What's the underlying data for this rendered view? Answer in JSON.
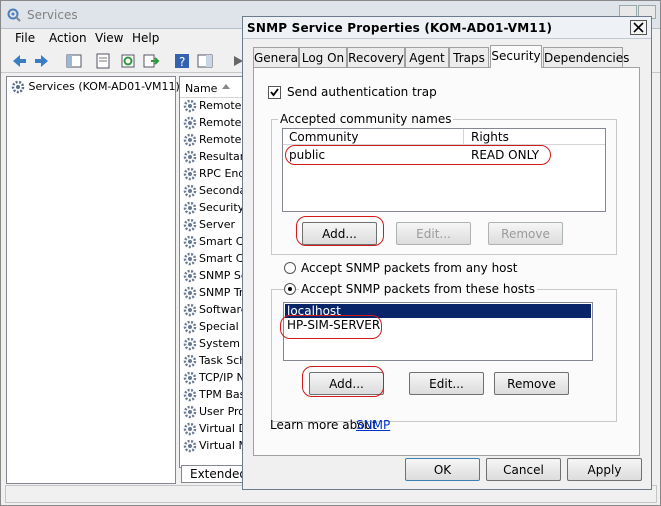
{
  "services_window": {
    "title": "Services",
    "menu": [
      "File",
      "Action",
      "View",
      "Help"
    ],
    "tree_root": "Services (KOM-AD01-VM11)",
    "list_column": "Name",
    "list_items": [
      "Remote",
      "Remote",
      "Remote",
      "Resultar",
      "RPC End",
      "Seconda",
      "Security",
      "Server",
      "Smart Ca",
      "Smart Ca",
      "SNMP Se",
      "SNMP Tr",
      "Software",
      "Special A",
      "System E",
      "Task Sch",
      "TCP/IP N",
      "TPM Bas",
      "User Pro",
      "Virtual D",
      "Virtual M"
    ],
    "bottom_tab": "Extended"
  },
  "dialog": {
    "title": "SNMP Service Properties (KOM-AD01-VM11)",
    "tabs": [
      "General",
      "Log On",
      "Recovery",
      "Agent",
      "Traps",
      "Security",
      "Dependencies"
    ],
    "active_tab": "Security",
    "send_auth_trap_label": "Send authentication trap",
    "send_auth_trap_checked": true,
    "community_group_title": "Accepted community names",
    "community_columns": [
      "Community",
      "Rights"
    ],
    "community_rows": [
      {
        "community": "public",
        "rights": "READ ONLY"
      }
    ],
    "community_buttons": {
      "add": "Add...",
      "edit": "Edit...",
      "remove": "Remove"
    },
    "accept_any_host_label": "Accept SNMP packets from any host",
    "accept_these_hosts_label": "Accept SNMP packets from these hosts",
    "selected_radio": "these_hosts",
    "hosts": [
      "localhost",
      "HP-SIM-SERVER"
    ],
    "selected_host": "localhost",
    "host_buttons": {
      "add": "Add...",
      "edit": "Edit...",
      "remove": "Remove"
    },
    "learn_more_text": "Learn more about",
    "learn_more_link": "SNMP",
    "footer_buttons": {
      "ok": "OK",
      "cancel": "Cancel",
      "apply": "Apply"
    }
  },
  "colors": {
    "annotation": "#d21a1a",
    "selection": "#0a246a",
    "link": "#0033cc"
  }
}
